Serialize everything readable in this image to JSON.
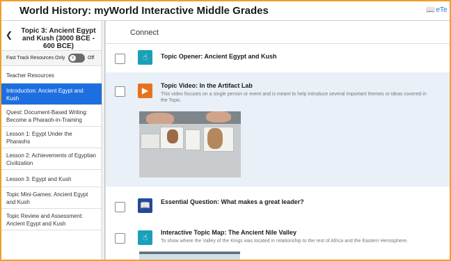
{
  "header": {
    "title": "World History: myWorld Interactive Middle Grades",
    "etext_label": "eTe"
  },
  "sidebar": {
    "topic_title": "Topic 3: Ancient Egypt and Kush (3000 BCE - 600 BCE)",
    "fast_track_label": "Fast Track Resources Only",
    "fast_track_state": "Off",
    "items": [
      {
        "label": "Teacher Resources"
      },
      {
        "label": "Introduction: Ancient Egypt and Kush"
      },
      {
        "label": "Quest: Document-Based Writing: Become a Pharaoh-in-Training"
      },
      {
        "label": "Lesson 1: Egypt Under the Pharaohs"
      },
      {
        "label": "Lesson 2: Achievements of Egyptian Civilization"
      },
      {
        "label": "Lesson 3: Egypt and Kush"
      },
      {
        "label": "Topic Mini-Games: Ancient Egypt and Kush"
      },
      {
        "label": "Topic Review and Assessment: Ancient Egypt and Kush"
      }
    ],
    "active_index": 1
  },
  "main": {
    "section_title": "Connect",
    "resources": [
      {
        "title": "Topic Opener: Ancient Egypt and Kush",
        "icon": "hand-pointer-icon",
        "description": ""
      },
      {
        "title": "Topic Video: In the Artifact Lab",
        "icon": "play-icon",
        "description_line1": "This video focuses on a single person or event and is meant to help introduce several important themes or ideas covered in",
        "description_line2": "the Topic."
      },
      {
        "title": "Essential Question: What makes a great leader?",
        "icon": "book-icon",
        "description": ""
      },
      {
        "title": "Interactive Topic Map: The Ancient Nile Valley",
        "icon": "hand-pointer-icon",
        "description": "To show where the Valley of the Kings was located in relationship to the rest of Africa and the Eastern Hemisphere."
      }
    ]
  },
  "colors": {
    "accent_blue": "#1d6fe0",
    "frame_orange": "#f39c2b",
    "teal_tile": "#1aa0b8",
    "orange_tile": "#e8721c",
    "navy_tile": "#1e4c9c"
  }
}
